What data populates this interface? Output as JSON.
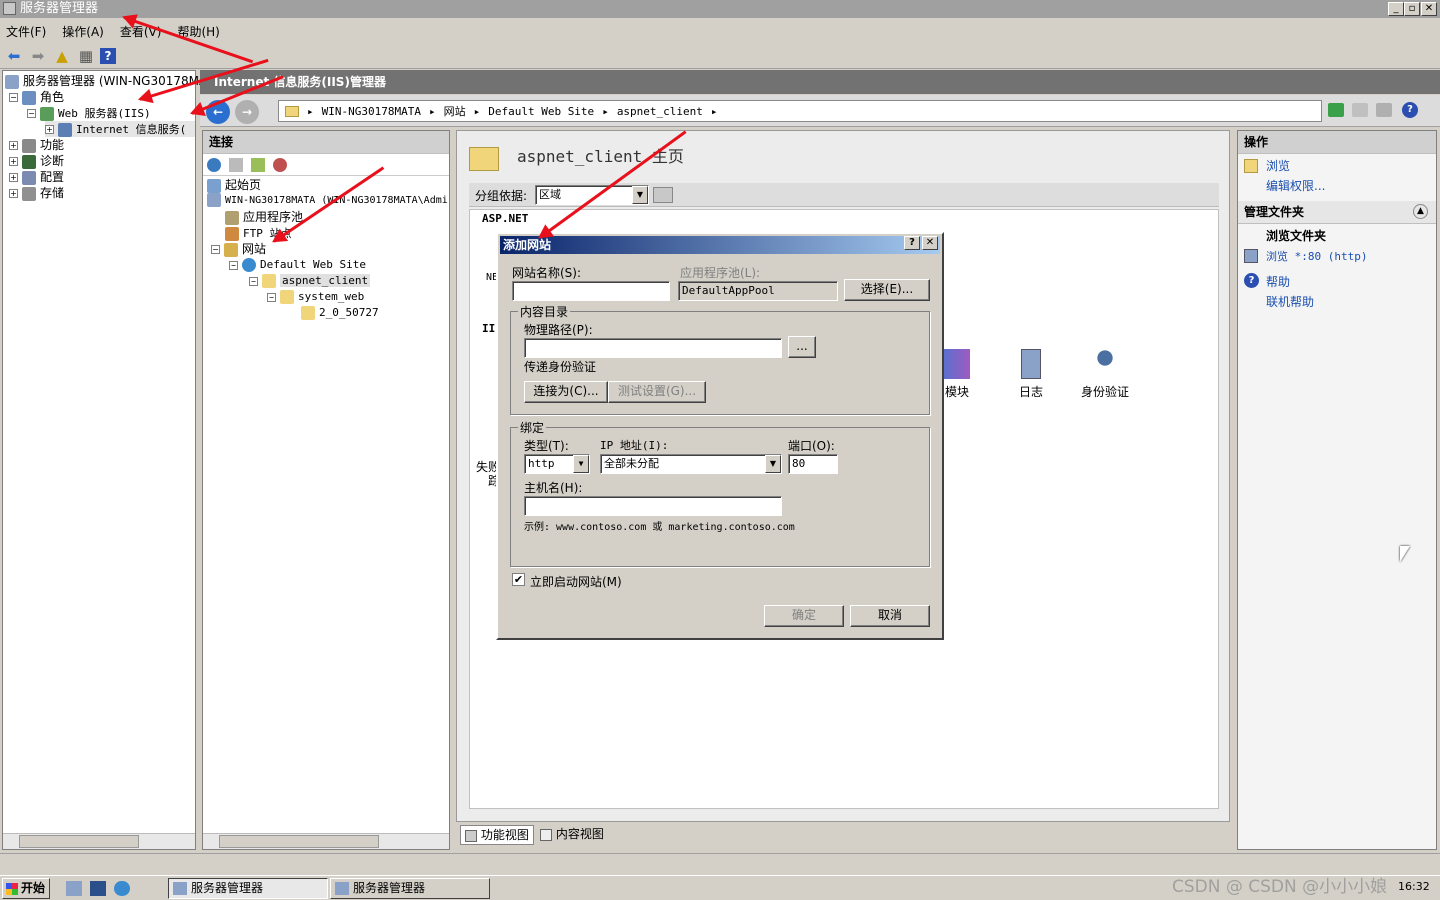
{
  "window": {
    "title": "服务器管理器",
    "min": "_",
    "max": "▫",
    "close": "✕"
  },
  "menu": [
    "文件(F)",
    "操作(A)",
    "查看(V)",
    "帮助(H)"
  ],
  "left_tree": {
    "root": "服务器管理器 (WIN-NG30178MAT",
    "roles": "角色",
    "web": "Web 服务器(IIS)",
    "iis": "Internet 信息服务(",
    "features": "功能",
    "diag": "诊断",
    "config": "配置",
    "storage": "存储"
  },
  "iis_header": "Internet 信息服务(IIS)管理器",
  "breadcrumb": [
    "WIN-NG30178MATA",
    "网站",
    "Default Web Site",
    "aspnet_client"
  ],
  "connections": {
    "title": "连接",
    "start": "起始页",
    "server": "WIN-NG30178MATA (WIN-NG30178MATA\\Admi",
    "apppools": "应用程序池",
    "ftp": "FTP 站点",
    "sites": "网站",
    "default_site": "Default Web Site",
    "aspnet": "aspnet_client",
    "sysweb": "system_web",
    "ver": "2_0_50727"
  },
  "center": {
    "title": "aspnet_client 主页",
    "group_label": "分组依据:",
    "group_value": "区域",
    "aspnet": "ASP.NET",
    "ne": "NE",
    "iis": "IIS",
    "fail": "失败",
    "fail2": "踪",
    "features": [
      {
        "label": "模块"
      },
      {
        "label": "日志"
      },
      {
        "label": "身份验证"
      }
    ],
    "view_features": "功能视图",
    "view_content": "内容视图"
  },
  "actions": {
    "title": "操作",
    "browse": "浏览",
    "edit_perms": "编辑权限...",
    "manage_title": "管理文件夹",
    "browse_folder": "浏览文件夹",
    "browse_80": "浏览 *:80 (http)",
    "help": "帮助",
    "online_help": "联机帮助"
  },
  "dialog": {
    "title": "添加网站",
    "help_btn": "?",
    "close_btn": "✕",
    "site_name_label": "网站名称(S):",
    "site_name": "",
    "app_pool_label": "应用程序池(L):",
    "app_pool": "DefaultAppPool",
    "select_btn": "选择(E)...",
    "content_dir": "内容目录",
    "phys_path_label": "物理路径(P):",
    "phys_path": "",
    "browse_btn": "...",
    "passthrough": "传递身份验证",
    "connect_as": "连接为(C)...",
    "test_settings": "测试设置(G)...",
    "binding": "绑定",
    "type_label": "类型(T):",
    "type": "http",
    "ip_label": "IP 地址(I):",
    "ip": "全部未分配",
    "port_label": "端口(O):",
    "port": "80",
    "host_label": "主机名(H):",
    "host": "",
    "example": "示例: www.contoso.com 或 marketing.contoso.com",
    "start_now": "立即启动网站(M)",
    "start_now_checked": true,
    "ok": "确定",
    "cancel": "取消"
  },
  "taskbar": {
    "start": "开始",
    "tasks": [
      "服务器管理器",
      "服务器管理器"
    ],
    "watermark": "CSDN @ CSDN @小小小娘",
    "clock": "16:32"
  },
  "colors": {
    "accent": "#0a246a",
    "arrow": "#e8101a",
    "link": "#1a4fb0"
  }
}
